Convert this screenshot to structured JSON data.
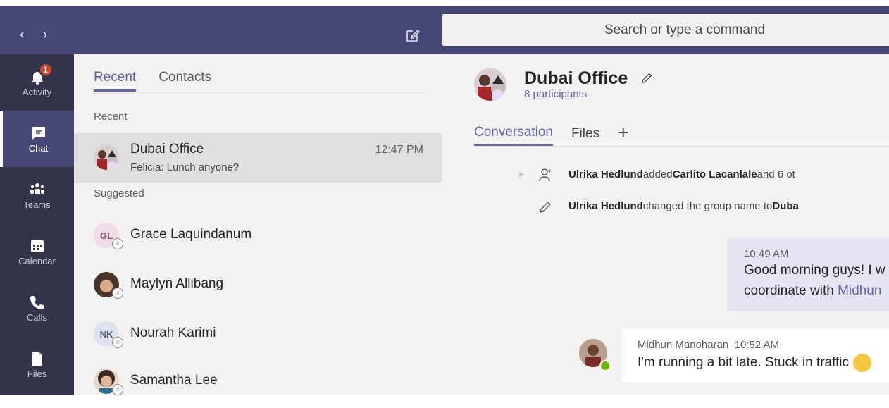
{
  "topbar": {
    "search_placeholder": "Search or type a command"
  },
  "rail": {
    "items": [
      {
        "label": "Activity",
        "badge": "1"
      },
      {
        "label": "Chat"
      },
      {
        "label": "Teams"
      },
      {
        "label": "Calendar"
      },
      {
        "label": "Calls"
      },
      {
        "label": "Files"
      }
    ]
  },
  "list": {
    "tabs": [
      "Recent",
      "Contacts"
    ],
    "recent_label": "Recent",
    "suggested_label": "Suggested",
    "chats": [
      {
        "name": "Dubai Office",
        "preview": "Felicia: Lunch anyone?",
        "time": "12:47 PM"
      }
    ],
    "suggested": [
      {
        "name": "Grace Laquindanum",
        "initials": "GL"
      },
      {
        "name": "Maylyn Allibang"
      },
      {
        "name": "Nourah Karimi",
        "initials": "NK"
      },
      {
        "name": "Samantha Lee"
      }
    ]
  },
  "chat": {
    "title": "Dubai Office",
    "participants": "8 participants",
    "tabs": [
      "Conversation",
      "Files"
    ],
    "events": [
      {
        "actor": "Ulrika Hedlund",
        "text1": " added ",
        "target": "Carlito Lacanlale",
        "text2": " and 6 ot"
      },
      {
        "actor": "Ulrika Hedlund",
        "text1": " changed the group name to ",
        "target": "Duba",
        "text2": ""
      }
    ],
    "my_message": {
      "time": "10:49 AM",
      "line1": "Good morning guys! I w",
      "line2_prefix": "coordinate with ",
      "mention": "Midhun"
    },
    "message": {
      "author": "Midhun Manoharan",
      "time": "10:52 AM",
      "text": "I'm running a bit late. Stuck in traffic"
    }
  },
  "colors": {
    "brand": "#464775",
    "accent": "#6264a7",
    "rail": "#33344a",
    "badge": "#cc4a31",
    "online": "#6bb700"
  }
}
